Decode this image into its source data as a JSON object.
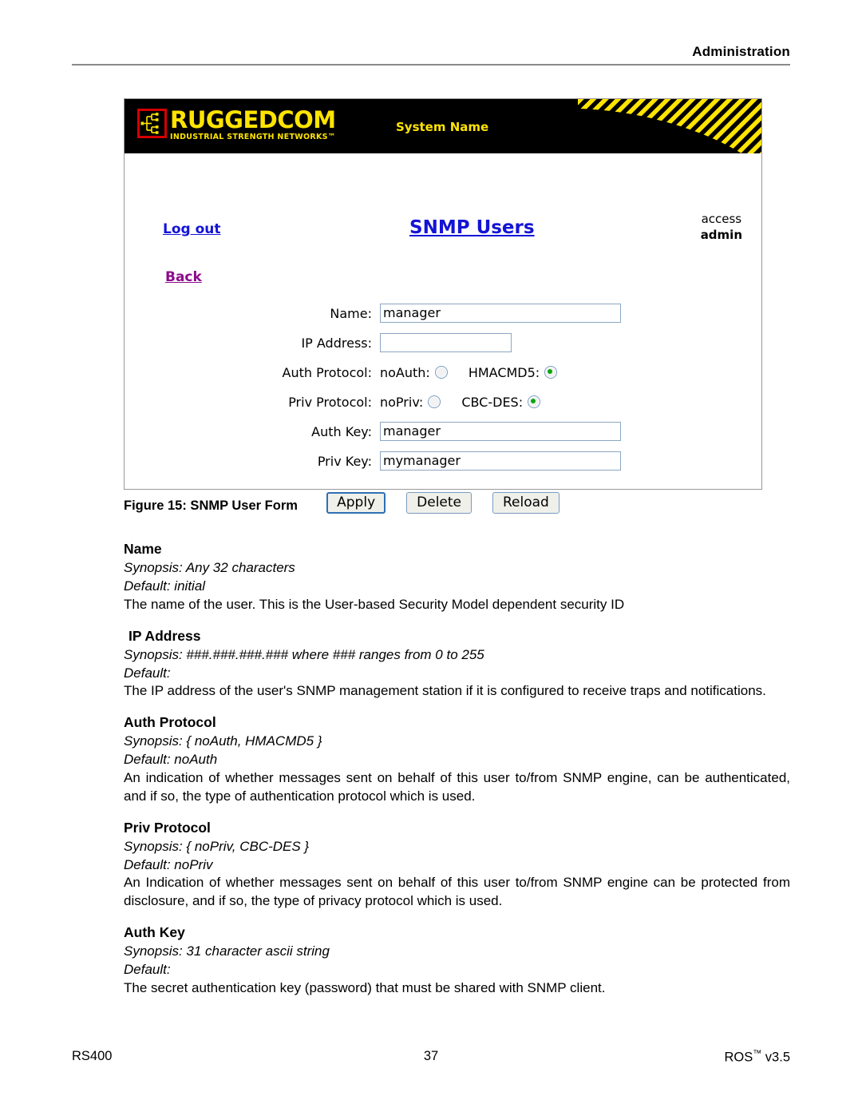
{
  "header": {
    "running_head": "Administration"
  },
  "figure": {
    "brand": {
      "logo_main": "RUGGEDCOM",
      "logo_sub": "INDUSTRIAL STRENGTH NETWORKS™",
      "system_name": "System Name"
    },
    "nav": {
      "logout": "Log out",
      "title": "SNMP Users",
      "back": "Back"
    },
    "access": {
      "label": "access",
      "value": "admin"
    },
    "form": {
      "fields": [
        {
          "label": "Name:",
          "value": "manager",
          "placeholder": "",
          "width": "wide"
        },
        {
          "label": "IP Address:",
          "value": "",
          "placeholder": "",
          "width": "small"
        },
        {
          "label": "Auth Key:",
          "value": "manager",
          "placeholder": "",
          "width": "wide"
        },
        {
          "label": "Priv Key:",
          "value": "mymanager",
          "placeholder": "",
          "width": "wide"
        }
      ],
      "auth_protocol": {
        "label": "Auth Protocol:",
        "options": [
          {
            "label": "noAuth:",
            "selected": false
          },
          {
            "label": "HMACMD5:",
            "selected": true
          }
        ]
      },
      "priv_protocol": {
        "label": "Priv Protocol:",
        "options": [
          {
            "label": "noPriv:",
            "selected": false
          },
          {
            "label": "CBC-DES:",
            "selected": true
          }
        ]
      },
      "buttons": [
        {
          "label": "Apply",
          "focused": true
        },
        {
          "label": "Delete",
          "focused": false
        },
        {
          "label": "Reload",
          "focused": false
        }
      ]
    },
    "caption": "Figure 15: SNMP User Form"
  },
  "sections": [
    {
      "title": "Name",
      "indented": false,
      "synopsis": "Synopsis: Any 32 characters",
      "default": "Default: initial",
      "description": "The name of the user. This is the User-based Security Model dependent security ID",
      "justify": false
    },
    {
      "title": "IP Address",
      "indented": true,
      "synopsis": "Synopsis: ###.###.###.###  where ### ranges from 0 to 255",
      "default": "Default:",
      "description": "The IP address of the user's SNMP management station if it is configured to receive traps and notifications.",
      "justify": false
    },
    {
      "title": "Auth Protocol",
      "indented": false,
      "synopsis": "Synopsis: { noAuth, HMACMD5 }",
      "default": "Default: noAuth",
      "description": "An indication of whether messages sent on behalf of this user to/from SNMP engine, can be authenticated, and if so, the type of authentication protocol which is used.",
      "justify": true
    },
    {
      "title": "Priv Protocol",
      "indented": false,
      "synopsis": "Synopsis: { noPriv, CBC-DES }",
      "default": "Default: noPriv",
      "description": "An Indication of whether messages sent on behalf of this user to/from SNMP engine can be protected from disclosure, and if so, the type of privacy protocol which is used.",
      "justify": true
    },
    {
      "title": "Auth Key",
      "indented": false,
      "synopsis": "Synopsis: 31 character ascii string",
      "default": "Default:",
      "description": "The secret authentication key (password) that must be shared with SNMP client.",
      "justify": false
    }
  ],
  "footer": {
    "left": "RS400",
    "center": "37",
    "right_product": "ROS",
    "right_tm": "™",
    "right_version": " v3.5"
  },
  "colors": {
    "brand_yellow": "#FFE400",
    "brand_red": "#D40000",
    "link_blue": "#1414D6",
    "link_visited": "#8C0A8C",
    "radio_selected_green": "#0AA60A",
    "field_border": "#8BA7C4"
  }
}
